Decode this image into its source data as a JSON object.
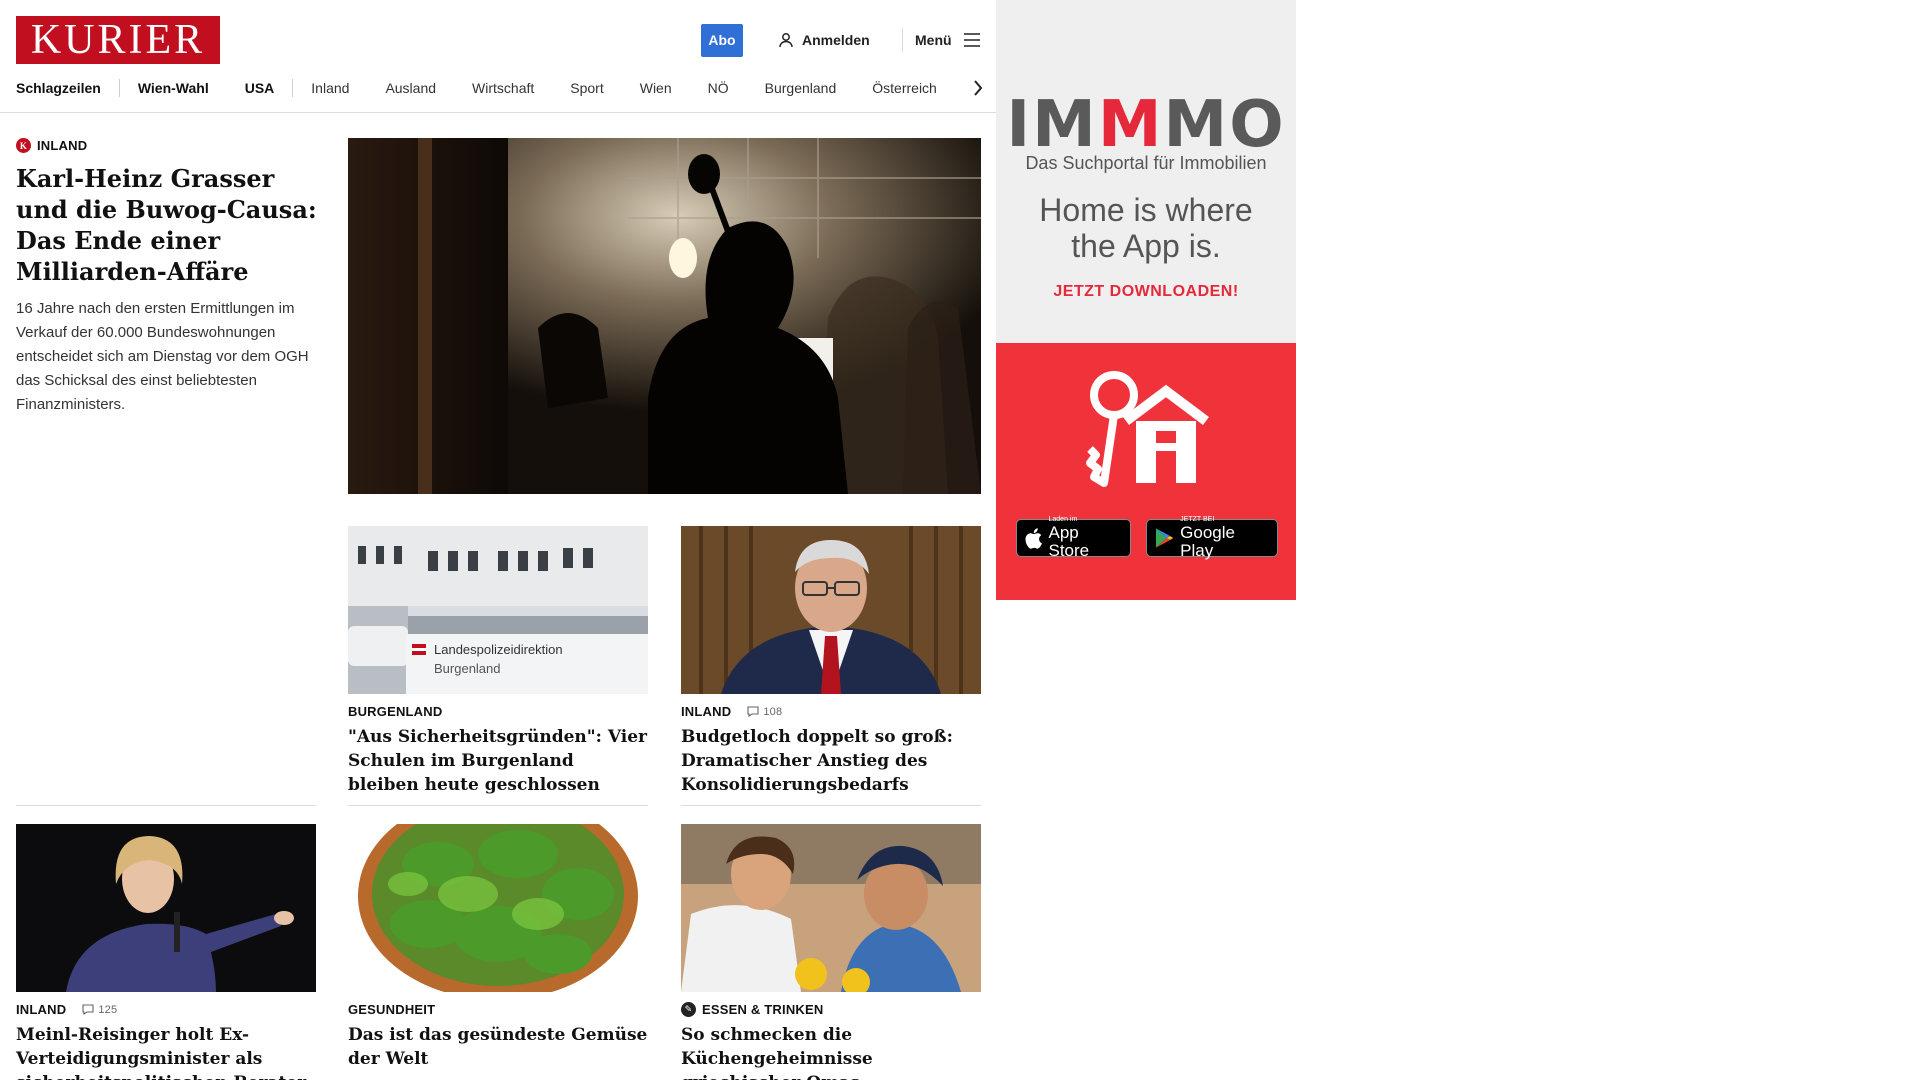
{
  "header": {
    "logo": "KURIER",
    "abo_label": "Abo",
    "login_label": "Anmelden",
    "menu_label": "Menü"
  },
  "nav": {
    "items": [
      "Schlagzeilen",
      "Wien-Wahl",
      "USA",
      "Inland",
      "Ausland",
      "Wirtschaft",
      "Sport",
      "Wien",
      "NÖ",
      "Burgenland",
      "Österreich"
    ]
  },
  "lead": {
    "kicker": "INLAND",
    "title": "Karl-Heinz Grasser und die Buwog-Causa: Das Ende einer Milliarden-Affäre",
    "teaser": "16 Jahre nach den ersten Ermittlungen im Verkauf der 60.000 Bundeswohnungen entscheidet sich am Dienstag vor dem OGH das Schicksal des einst beliebtesten Finanzministers."
  },
  "cards": [
    {
      "kicker": "BURGENLAND",
      "title": "\"Aus Sicherheitsgründen\": Vier Schulen im Burgenland bleiben heute geschlossen",
      "sign_line1": "Landespolizeidirektion",
      "sign_line2": "Burgenland"
    },
    {
      "kicker": "INLAND",
      "comments": "108",
      "title": "Budgetloch doppelt so groß: Dramatischer Anstieg des Konsolidierungsbedarfs"
    },
    {
      "kicker": "INLAND",
      "comments": "125",
      "title": "Meinl-Reisinger holt Ex-Verteidigungsminister als sicherheitspolitischen Berater"
    },
    {
      "kicker": "GESUNDHEIT",
      "title": "Das ist das gesündeste Gemüse der Welt"
    },
    {
      "kicker": "ESSEN & TRINKEN",
      "title": "So schmecken die Küchengeheimnisse griechischer Omas"
    }
  ],
  "ad": {
    "brand_parts": [
      "IM",
      "M",
      "MO"
    ],
    "subtitle": "Das Suchportal für Immobilien",
    "headline": "Home is where the App is.",
    "cta": "JETZT DOWNLOADEN!",
    "appstore_small": "Laden im",
    "appstore_big": "App Store",
    "googleplay_small": "JETZT BEI",
    "googleplay_big": "Google Play"
  },
  "colors": {
    "brand_red": "#c10f1f",
    "abo_blue": "#2f6fd6",
    "ad_red": "#f0323b"
  }
}
